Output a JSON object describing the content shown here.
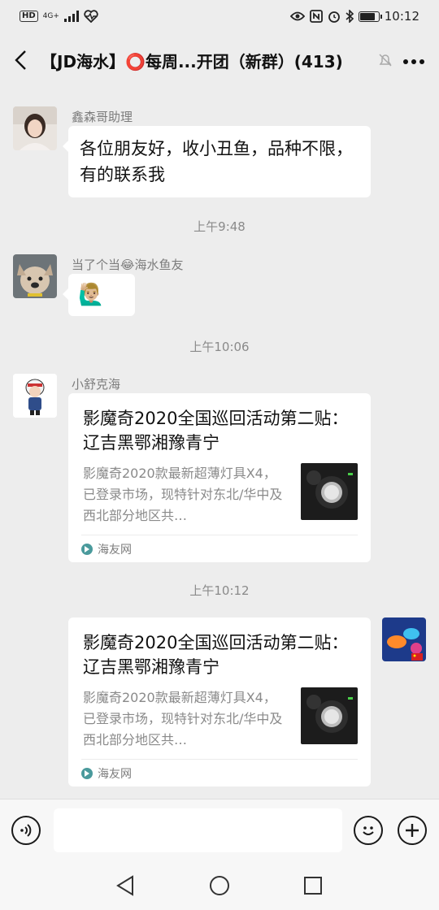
{
  "status_bar": {
    "left_badge": "HD",
    "network": "4G+",
    "time": "10:12"
  },
  "header": {
    "title": "【JD海水】⭕每周...开团（新群）(413)",
    "icons": [
      "back-arrow-icon",
      "mute-bell-icon",
      "more-icon"
    ]
  },
  "messages": [
    {
      "sender": "鑫森哥助理",
      "text": "各位朋友好，收小丑鱼，品种不限，有的联系我",
      "avatar": "woman-avatar"
    },
    {
      "sender": "当了个当😂海水鱼友",
      "text": "🙋🏼‍♂",
      "avatar": "bulldog-avatar"
    },
    {
      "sender": "小舒克海",
      "avatar": "pilot-cartoon-avatar",
      "card": {
        "title": "影魔奇2020全国巡回活动第二贴： 辽吉黑鄂湘豫青宁",
        "description": "影魔奇2020款最新超薄灯具X4，已登录市场，现特针对东北/华中及西北部分地区共…",
        "source": "海友网"
      }
    },
    {
      "sender": "",
      "avatar": "aquarium-avatar",
      "self": true,
      "card": {
        "title": "影魔奇2020全国巡回活动第二贴： 辽吉黑鄂湘豫青宁",
        "description": "影魔奇2020款最新超薄灯具X4，已登录市场，现特针对东北/华中及西北部分地区共…",
        "source": "海友网"
      }
    }
  ],
  "timestamps": [
    "上午9:48",
    "上午10:06",
    "上午10:12"
  ],
  "input_bar": {
    "value": "",
    "icons": [
      "voice-icon",
      "emoji-icon",
      "plus-icon"
    ]
  },
  "nav_bar": {
    "icons": [
      "back-triangle-icon",
      "home-circle-icon",
      "recents-square-icon"
    ]
  },
  "colors": {
    "chat_background": "#ededed",
    "bubble": "#ffffff",
    "secondary_text": "#8a8a8a"
  }
}
